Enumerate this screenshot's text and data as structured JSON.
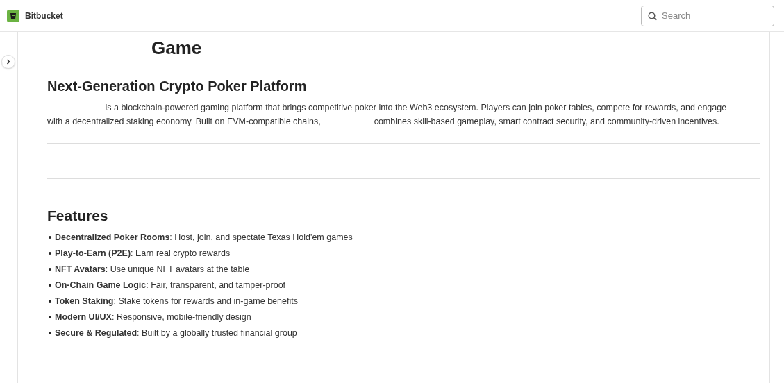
{
  "topbar": {
    "product": "Bitbucket",
    "search": {
      "placeholder": "Search"
    }
  },
  "readme": {
    "title": "Game",
    "subtitle": "Next-Generation Crypto Poker Platform",
    "intro_parts": [
      "is a blockchain-powered gaming platform that brings competitive poker into the Web3 ecosystem. Players can join poker tables, compete for rewards, and engage with a decentralized staking economy. Built on EVM-compatible chains,",
      "combines skill-based gameplay, smart contract security, and community-driven incentives."
    ],
    "features_heading": "Features",
    "features": [
      {
        "term": "Decentralized Poker Rooms",
        "text": ": Host, join, and spectate Texas Hold'em games"
      },
      {
        "term": "Play-to-Earn (P2E)",
        "text": ": Earn real crypto rewards"
      },
      {
        "term": "NFT Avatars",
        "text": ": Use unique NFT avatars at the table"
      },
      {
        "term": "On-Chain Game Logic",
        "text": ": Fair, transparent, and tamper-proof"
      },
      {
        "term": "Token Staking",
        "text": ": Stake tokens for rewards and in-game benefits"
      },
      {
        "term": "Modern UI/UX",
        "text": ": Responsive, mobile-friendly design"
      },
      {
        "term": "Secure & Regulated",
        "text": ": Built by a globally trusted financial group"
      }
    ]
  }
}
